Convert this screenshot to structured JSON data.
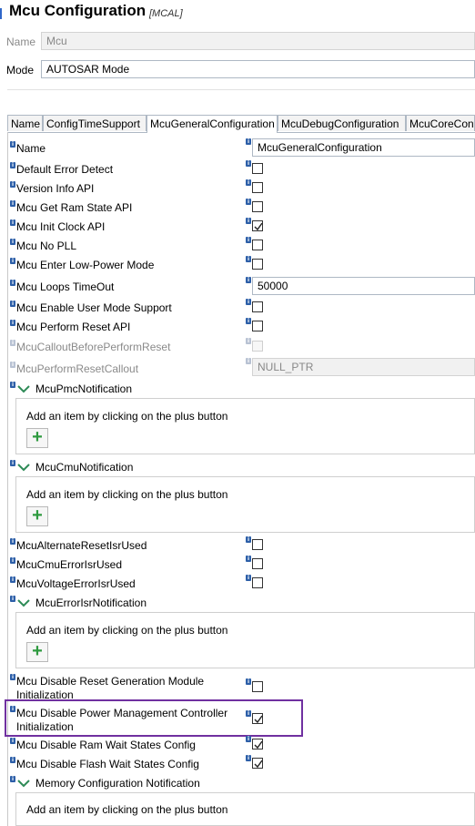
{
  "header": {
    "title": "Mcu Configuration",
    "tag": "[MCAL]"
  },
  "top_fields": {
    "name_label": "Name",
    "name_value": "Mcu",
    "mode_label": "Mode",
    "mode_value": "AUTOSAR Mode"
  },
  "tabs": [
    {
      "label": "Name",
      "active": false
    },
    {
      "label": "ConfigTimeSupport",
      "active": false
    },
    {
      "label": "McuGeneralConfiguration",
      "active": true
    },
    {
      "label": "McuDebugConfiguration",
      "active": false
    },
    {
      "label": "McuCoreConfi",
      "active": false
    }
  ],
  "form": {
    "name_label": "Name",
    "name_value": "McuGeneralConfiguration",
    "rows": [
      {
        "label": "Default Error Detect",
        "checked": false,
        "disabled": false
      },
      {
        "label": "Version Info API",
        "checked": false,
        "disabled": false
      },
      {
        "label": "Mcu Get Ram State API",
        "checked": false,
        "disabled": false
      },
      {
        "label": "Mcu Init Clock API",
        "checked": true,
        "disabled": false
      },
      {
        "label": "Mcu No PLL",
        "checked": false,
        "disabled": false
      },
      {
        "label": "Mcu Enter Low-Power Mode",
        "checked": false,
        "disabled": false
      }
    ],
    "loops_timeout_label": "Mcu Loops TimeOut",
    "loops_timeout_value": "50000",
    "rows2": [
      {
        "label": "Mcu Enable User Mode Support",
        "checked": false,
        "disabled": false
      },
      {
        "label": "Mcu Perform Reset API",
        "checked": false,
        "disabled": false
      },
      {
        "label": "McuCalloutBeforePerformReset",
        "checked": false,
        "disabled": true
      }
    ],
    "reset_callout_label": "McuPerformResetCallout",
    "reset_callout_value": "NULL_PTR",
    "lists": [
      {
        "label": "McuPmcNotification",
        "hint": "Add an item by clicking on the plus button",
        "add": "+"
      },
      {
        "label": "McuCmuNotification",
        "hint": "Add an item by clicking on the plus button",
        "add": "+"
      }
    ],
    "rows3": [
      {
        "label": "McuAlternateResetIsrUsed",
        "checked": false
      },
      {
        "label": "McuCmuErrorIsrUsed",
        "checked": false
      },
      {
        "label": "McuVoltageErrorIsrUsed",
        "checked": false
      }
    ],
    "error_list": {
      "label": "McuErrorIsrNotification",
      "hint": "Add an item by clicking on the plus button",
      "add": "+"
    },
    "disable_reset_gen": {
      "line1": "Mcu Disable Reset Generation Module",
      "line2": "Initialization",
      "checked": false
    },
    "disable_pmc": {
      "line1": "Mcu Disable Power Management Controller",
      "line2": "Initialization",
      "checked": true
    },
    "rows4": [
      {
        "label": "Mcu Disable Ram Wait States Config",
        "checked": true
      },
      {
        "label": "Mcu Disable Flash Wait States Config",
        "checked": true
      }
    ],
    "memory_list": {
      "label": "Memory Configuration Notification",
      "hint": "Add an item by clicking on the plus button",
      "add": "+"
    }
  },
  "colors": {
    "accent": "#2d5fa8",
    "highlight": "#7030a0",
    "plus": "#2e9a3f"
  }
}
